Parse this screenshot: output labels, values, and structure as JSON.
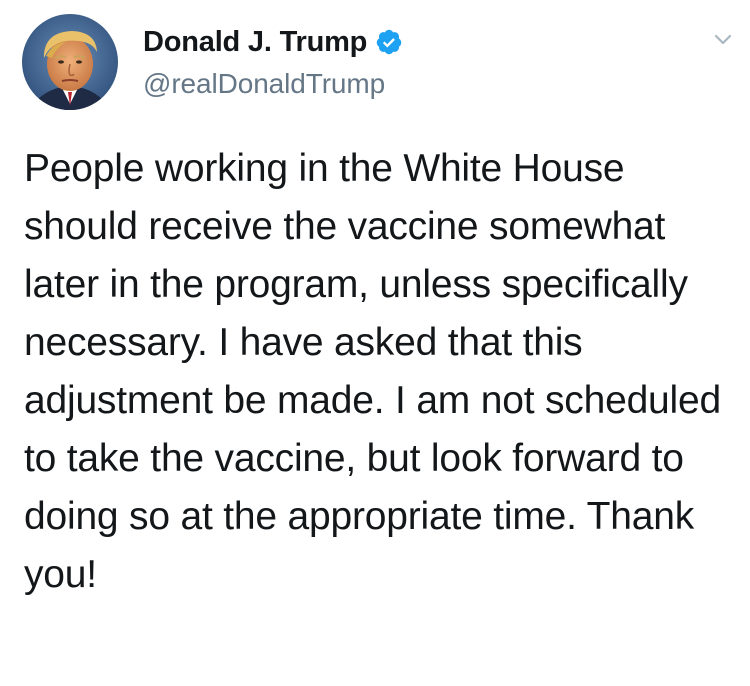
{
  "author": {
    "display_name": "Donald J. Trump",
    "handle": "@realDonaldTrump",
    "verified": true,
    "avatar_icon": "profile-photo"
  },
  "tweet": {
    "text": "People working in the White House should receive the vaccine somewhat later in the program, unless specifically necessary. I have asked that this adjustment be made. I am not scheduled to take the vaccine, but look forward to doing so at the appropriate time. Thank you!"
  },
  "icons": {
    "verified_badge": "verified-badge-icon",
    "more_menu": "chevron-down-icon"
  },
  "colors": {
    "verified_blue": "#1da1f2",
    "text_primary": "#14171a",
    "text_secondary": "#657786",
    "caret": "#aab8c2"
  }
}
